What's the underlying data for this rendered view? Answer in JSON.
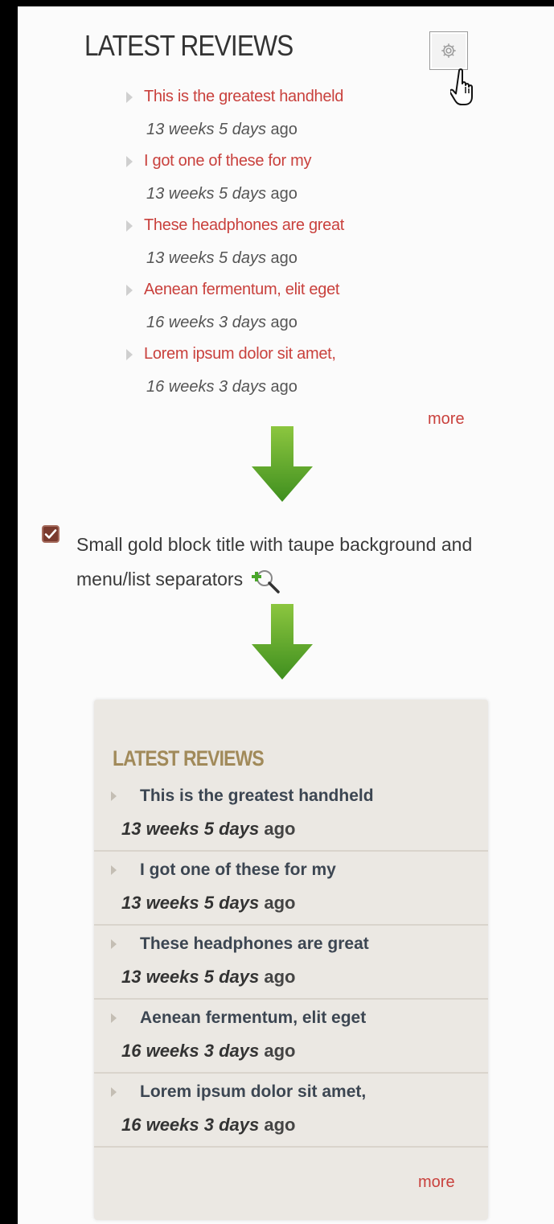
{
  "top_block": {
    "title": "LATEST REVIEWS",
    "configure_icon": "gear-icon",
    "items": [
      {
        "title": "This is the greatest handheld",
        "time": "13 weeks 5 days",
        "suffix": "ago"
      },
      {
        "title": "I got one of these for my",
        "time": "13 weeks 5 days",
        "suffix": "ago"
      },
      {
        "title": "These headphones are great",
        "time": "13 weeks 5 days",
        "suffix": "ago"
      },
      {
        "title": "Aenean fermentum, elit eget",
        "time": "16 weeks 3 days",
        "suffix": "ago"
      },
      {
        "title": "Lorem ipsum dolor sit amet,",
        "time": "16 weeks 3 days",
        "suffix": "ago"
      }
    ],
    "more": "more"
  },
  "option": {
    "checked": true,
    "label": "Small gold block title with taupe background and menu/list separators",
    "zoom_icon": "zoom-plus-icon"
  },
  "styled_block": {
    "title": "LATEST REVIEWS",
    "items": [
      {
        "title": "This is the greatest handheld",
        "time": "13 weeks 5 days",
        "suffix": "ago"
      },
      {
        "title": "I got one of these for my",
        "time": "13 weeks 5 days",
        "suffix": "ago"
      },
      {
        "title": "These headphones are great",
        "time": "13 weeks 5 days",
        "suffix": "ago"
      },
      {
        "title": "Aenean fermentum, elit eget",
        "time": "16 weeks 3 days",
        "suffix": "ago"
      },
      {
        "title": "Lorem ipsum dolor sit amet,",
        "time": "16 weeks 3 days",
        "suffix": "ago"
      }
    ],
    "more": "more"
  },
  "colors": {
    "link_red": "#c9413d",
    "gold_title": "#a18a5a",
    "taupe_background": "#ebe8e3",
    "arrow_green": "#5ea52a"
  }
}
